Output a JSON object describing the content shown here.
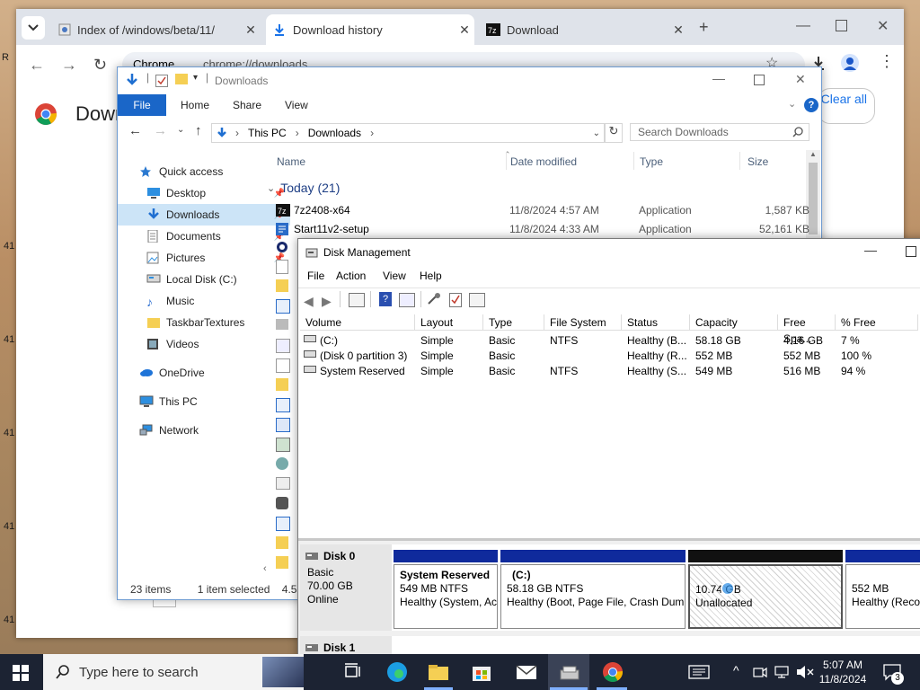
{
  "desktop": {
    "edge_numbers": [
      "41",
      "41",
      "41",
      "41",
      "41",
      "41"
    ]
  },
  "chrome": {
    "tabs": [
      {
        "title": "Index of /windows/beta/11/",
        "active": false
      },
      {
        "title": "Download history",
        "active": true
      },
      {
        "title": "Download",
        "active": false
      }
    ],
    "new_tab": "+",
    "address": "chrome://downloads",
    "site_label": "Chrome",
    "page_title": "Downl",
    "clear_all": "Clear all"
  },
  "explorer": {
    "title": "Downloads",
    "ribbon_tabs": [
      "File",
      "Home",
      "Share",
      "View"
    ],
    "breadcrumb": [
      "This PC",
      "Downloads"
    ],
    "search_placeholder": "Search Downloads",
    "nav": [
      {
        "label": "Quick access",
        "icon": "star-icon",
        "pinned": false
      },
      {
        "label": "Desktop",
        "icon": "desktop-icon",
        "pinned": true
      },
      {
        "label": "Downloads",
        "icon": "download-icon",
        "pinned": true,
        "selected": true
      },
      {
        "label": "Documents",
        "icon": "document-icon",
        "pinned": true
      },
      {
        "label": "Pictures",
        "icon": "picture-icon",
        "pinned": true
      },
      {
        "label": "Local Disk (C:)",
        "icon": "drive-icon",
        "pinned": false
      },
      {
        "label": "Music",
        "icon": "music-icon",
        "pinned": false
      },
      {
        "label": "TaskbarTextures",
        "icon": "folder-icon",
        "pinned": false
      },
      {
        "label": "Videos",
        "icon": "video-icon",
        "pinned": false
      },
      {
        "label": "OneDrive",
        "icon": "cloud-icon",
        "pinned": false
      },
      {
        "label": "This PC",
        "icon": "computer-icon",
        "pinned": false
      },
      {
        "label": "Network",
        "icon": "network-icon",
        "pinned": false
      }
    ],
    "columns": {
      "name": "Name",
      "date": "Date modified",
      "type": "Type",
      "size": "Size"
    },
    "group": "Today (21)",
    "files": [
      {
        "name": "7z2408-x64",
        "date": "11/8/2024 4:57 AM",
        "type": "Application",
        "size": "1,587 KB"
      },
      {
        "name": "Start11v2-setup",
        "date": "11/8/2024 4:33 AM",
        "type": "Application",
        "size": "52,161 KB"
      }
    ],
    "status": {
      "items": "23 items",
      "selected": "1 item selected",
      "size": "4.55 GB"
    }
  },
  "diskmgmt": {
    "title": "Disk Management",
    "menu": [
      "File",
      "Action",
      "View",
      "Help"
    ],
    "columns": [
      "Volume",
      "Layout",
      "Type",
      "File System",
      "Status",
      "Capacity",
      "Free Spa...",
      "% Free"
    ],
    "volumes": [
      {
        "volume": "(C:)",
        "layout": "Simple",
        "type": "Basic",
        "fs": "NTFS",
        "status": "Healthy (B...",
        "capacity": "58.18 GB",
        "free": "4.16 GB",
        "pct": "7 %"
      },
      {
        "volume": "(Disk 0 partition 3)",
        "layout": "Simple",
        "type": "Basic",
        "fs": "",
        "status": "Healthy (R...",
        "capacity": "552 MB",
        "free": "552 MB",
        "pct": "100 %"
      },
      {
        "volume": "System Reserved",
        "layout": "Simple",
        "type": "Basic",
        "fs": "NTFS",
        "status": "Healthy (S...",
        "capacity": "549 MB",
        "free": "516 MB",
        "pct": "94 %"
      }
    ],
    "disk0": {
      "name": "Disk 0",
      "type": "Basic",
      "size": "70.00 GB",
      "state": "Online"
    },
    "partitions": [
      {
        "title": "System Reserved",
        "line1": "549 MB NTFS",
        "line2": "Healthy (System, Ac"
      },
      {
        "title": "(C:)",
        "line1": "58.18 GB NTFS",
        "line2": "Healthy (Boot, Page File, Crash Dum"
      },
      {
        "title": "",
        "line1": "10.74 GB",
        "line2": "Unallocated"
      },
      {
        "title": "",
        "line1": "552 MB",
        "line2": "Healthy (Reco"
      }
    ],
    "disk1": {
      "name": "Disk 1"
    }
  },
  "taskbar": {
    "search_placeholder": "Type here to search",
    "time": "5:07 AM",
    "date": "11/8/2024",
    "notif_count": "3"
  }
}
